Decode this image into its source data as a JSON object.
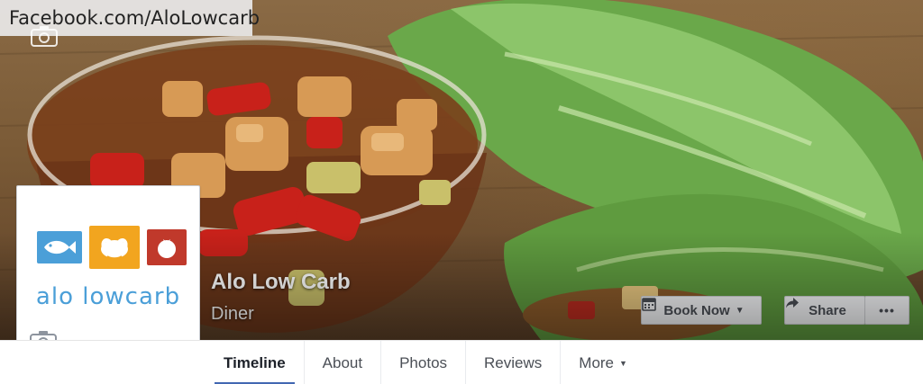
{
  "banner": {
    "url_text": "Facebook.com/AloLowcarb"
  },
  "profile": {
    "logo_text": "alo lowcarb",
    "logo_tiles": [
      "fish-icon",
      "chicken-icon",
      "tomato-icon"
    ]
  },
  "page": {
    "name": "Alo Low Carb",
    "category": "Diner"
  },
  "actions": {
    "book_now": "Book Now",
    "share": "Share",
    "more": "•••"
  },
  "tabs": [
    {
      "label": "Timeline",
      "active": true
    },
    {
      "label": "About",
      "active": false
    },
    {
      "label": "Photos",
      "active": false
    },
    {
      "label": "Reviews",
      "active": false
    },
    {
      "label": "More",
      "active": false
    }
  ],
  "colors": {
    "accent": "#4267b2",
    "logo_blue": "#4b9fd8",
    "logo_orange": "#f2a51f",
    "logo_red": "#c0392b"
  }
}
